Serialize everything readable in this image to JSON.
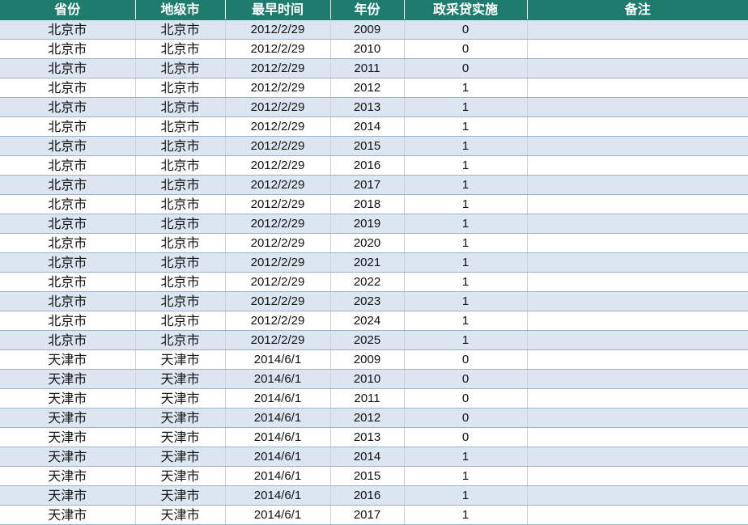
{
  "headers": [
    "省份",
    "地级市",
    "最早时间",
    "年份",
    "政采贷实施",
    "备注"
  ],
  "rows": [
    [
      "北京市",
      "北京市",
      "2012/2/29",
      "2009",
      "0",
      ""
    ],
    [
      "北京市",
      "北京市",
      "2012/2/29",
      "2010",
      "0",
      ""
    ],
    [
      "北京市",
      "北京市",
      "2012/2/29",
      "2011",
      "0",
      ""
    ],
    [
      "北京市",
      "北京市",
      "2012/2/29",
      "2012",
      "1",
      ""
    ],
    [
      "北京市",
      "北京市",
      "2012/2/29",
      "2013",
      "1",
      ""
    ],
    [
      "北京市",
      "北京市",
      "2012/2/29",
      "2014",
      "1",
      ""
    ],
    [
      "北京市",
      "北京市",
      "2012/2/29",
      "2015",
      "1",
      ""
    ],
    [
      "北京市",
      "北京市",
      "2012/2/29",
      "2016",
      "1",
      ""
    ],
    [
      "北京市",
      "北京市",
      "2012/2/29",
      "2017",
      "1",
      ""
    ],
    [
      "北京市",
      "北京市",
      "2012/2/29",
      "2018",
      "1",
      ""
    ],
    [
      "北京市",
      "北京市",
      "2012/2/29",
      "2019",
      "1",
      ""
    ],
    [
      "北京市",
      "北京市",
      "2012/2/29",
      "2020",
      "1",
      ""
    ],
    [
      "北京市",
      "北京市",
      "2012/2/29",
      "2021",
      "1",
      ""
    ],
    [
      "北京市",
      "北京市",
      "2012/2/29",
      "2022",
      "1",
      ""
    ],
    [
      "北京市",
      "北京市",
      "2012/2/29",
      "2023",
      "1",
      ""
    ],
    [
      "北京市",
      "北京市",
      "2012/2/29",
      "2024",
      "1",
      ""
    ],
    [
      "北京市",
      "北京市",
      "2012/2/29",
      "2025",
      "1",
      ""
    ],
    [
      "天津市",
      "天津市",
      "2014/6/1",
      "2009",
      "0",
      ""
    ],
    [
      "天津市",
      "天津市",
      "2014/6/1",
      "2010",
      "0",
      ""
    ],
    [
      "天津市",
      "天津市",
      "2014/6/1",
      "2011",
      "0",
      ""
    ],
    [
      "天津市",
      "天津市",
      "2014/6/1",
      "2012",
      "0",
      ""
    ],
    [
      "天津市",
      "天津市",
      "2014/6/1",
      "2013",
      "0",
      ""
    ],
    [
      "天津市",
      "天津市",
      "2014/6/1",
      "2014",
      "1",
      ""
    ],
    [
      "天津市",
      "天津市",
      "2014/6/1",
      "2015",
      "1",
      ""
    ],
    [
      "天津市",
      "天津市",
      "2014/6/1",
      "2016",
      "1",
      ""
    ],
    [
      "天津市",
      "天津市",
      "2014/6/1",
      "2017",
      "1",
      ""
    ]
  ],
  "colors": {
    "header_bg": "#1e7c6f",
    "header_text": "#ffffff",
    "band_row": "#dce6f1",
    "plain_row": "#ffffff"
  }
}
